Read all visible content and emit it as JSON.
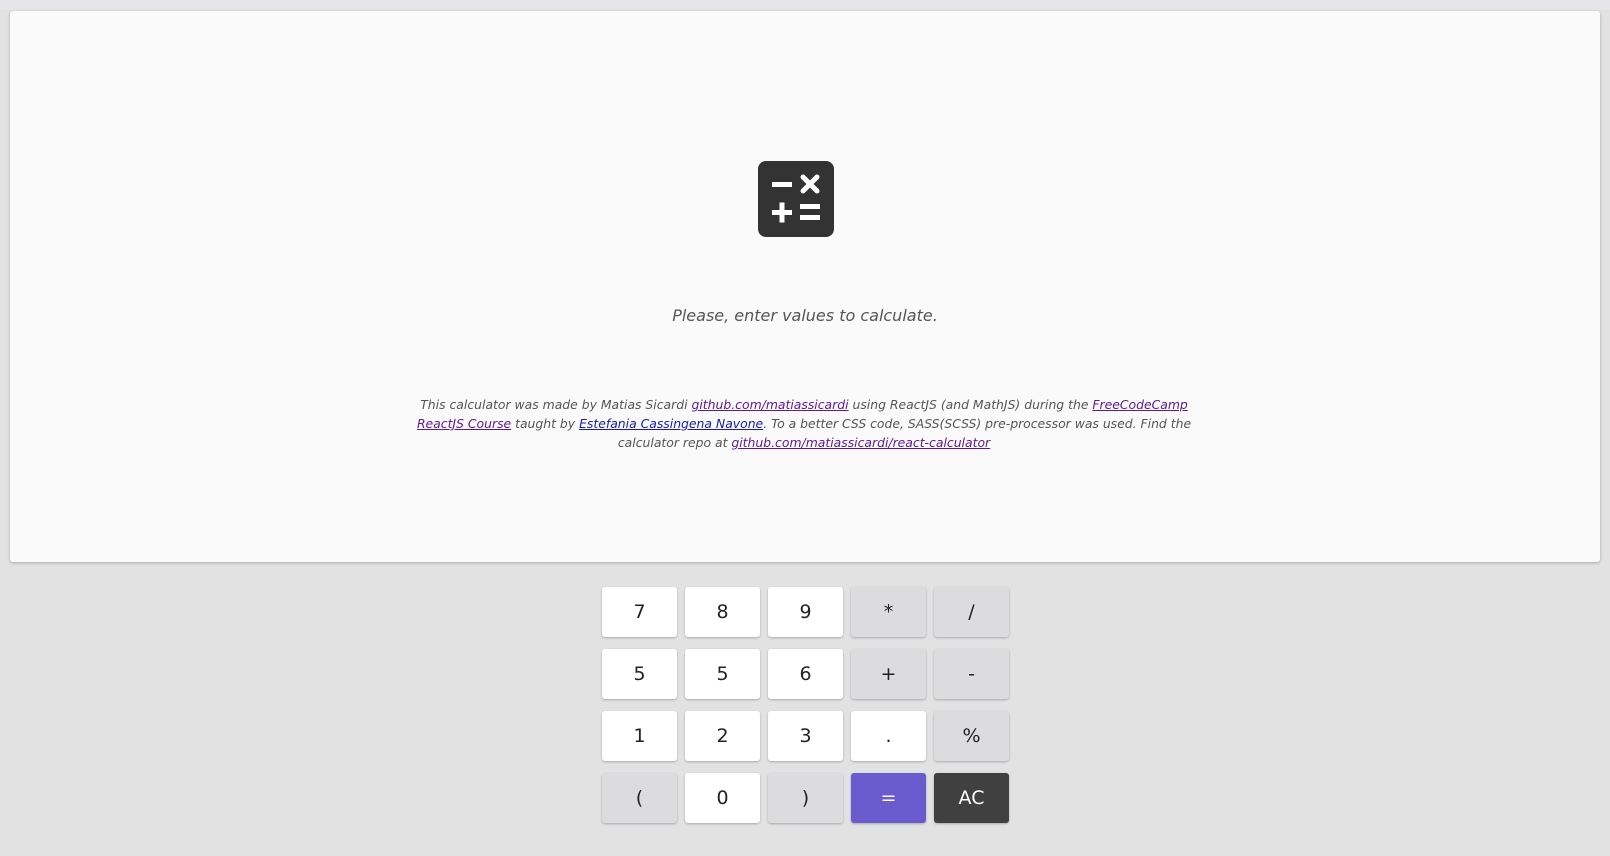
{
  "display": {
    "message": "Please, enter values to calculate.",
    "logo_icon": "calculator-icon"
  },
  "credits": {
    "t1": "This calculator was made by Matias Sicardi ",
    "link_github": "github.com/matiassicardi",
    "t2": " using ReactJS (and MathJS) during the ",
    "link_course": "FreeCodeCamp ReactJS Course",
    "t3": " taught by ",
    "link_teacher": "Estefania Cassingena Navone",
    "t4": ". To a better CSS code, SASS(SCSS) pre-processor was used. Find the calculator repo at ",
    "link_repo": "github.com/matiassicardi/react-calculator"
  },
  "keypad": {
    "keys": [
      {
        "label": "7",
        "kind": "num"
      },
      {
        "label": "8",
        "kind": "num"
      },
      {
        "label": "9",
        "kind": "num"
      },
      {
        "label": "*",
        "kind": "op"
      },
      {
        "label": "/",
        "kind": "op"
      },
      {
        "label": "5",
        "kind": "num"
      },
      {
        "label": "5",
        "kind": "num"
      },
      {
        "label": "6",
        "kind": "num"
      },
      {
        "label": "+",
        "kind": "op"
      },
      {
        "label": "-",
        "kind": "op"
      },
      {
        "label": "1",
        "kind": "num"
      },
      {
        "label": "2",
        "kind": "num"
      },
      {
        "label": "3",
        "kind": "num"
      },
      {
        "label": ".",
        "kind": "num"
      },
      {
        "label": "%",
        "kind": "op"
      },
      {
        "label": "(",
        "kind": "op"
      },
      {
        "label": "0",
        "kind": "num"
      },
      {
        "label": ")",
        "kind": "op"
      },
      {
        "label": "=",
        "kind": "eq"
      },
      {
        "label": "AC",
        "kind": "clear"
      }
    ]
  },
  "colors": {
    "equals": "#6a5acd",
    "clear": "#404040",
    "logo": "#333333"
  }
}
